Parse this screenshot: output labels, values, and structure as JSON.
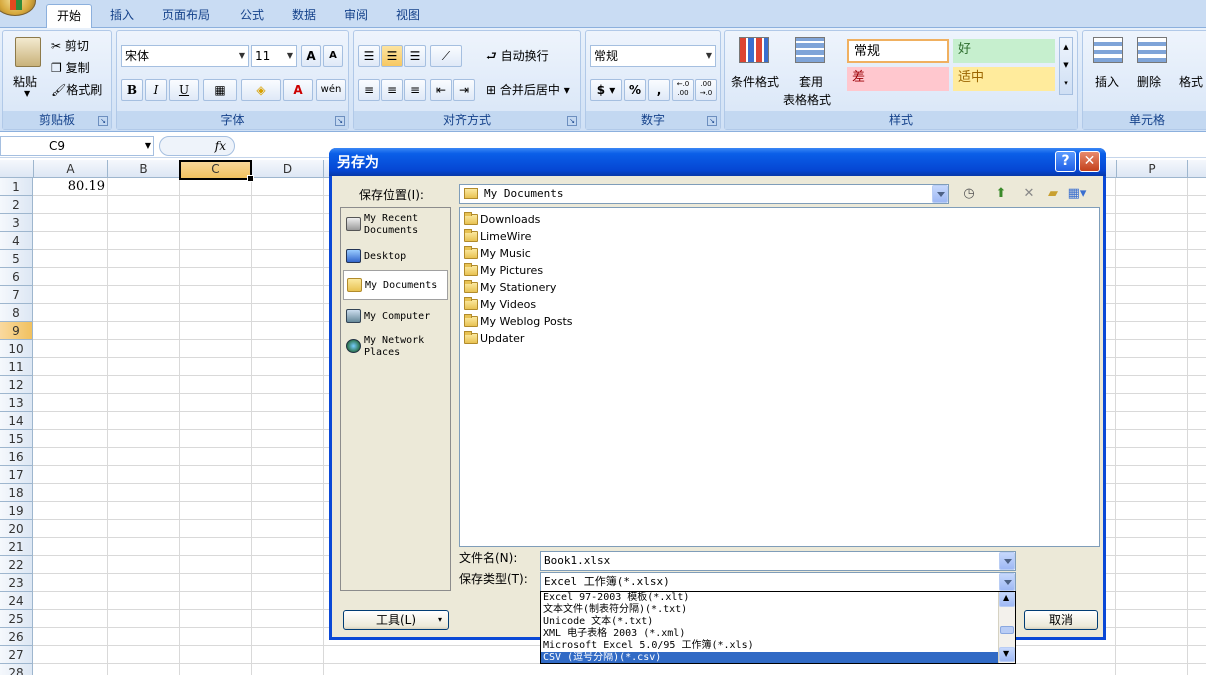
{
  "ribbon": {
    "tabs": [
      "开始",
      "插入",
      "页面布局",
      "公式",
      "数据",
      "审阅",
      "视图"
    ],
    "clipboard": {
      "paste": "粘贴",
      "cut": "剪切",
      "copy": "复制",
      "format_painter": "格式刷",
      "label": "剪贴板"
    },
    "font": {
      "name": "宋体",
      "size": "11",
      "bold": "B",
      "italic": "I",
      "underline": "U",
      "label": "字体",
      "grow": "A",
      "shrink": "A",
      "phonetic": "wén"
    },
    "alignment": {
      "wrap": "自动换行",
      "merge": "合并后居中",
      "label": "对齐方式"
    },
    "number": {
      "format": "常规",
      "currency": "$",
      "percent": "%",
      "comma": ",",
      "inc_decimal": "←.0 .00",
      "dec_decimal": ".00 →.0",
      "label": "数字"
    },
    "styles": {
      "cond_format": "条件格式",
      "table_format_1": "套用",
      "table_format_2": "表格格式",
      "normal": "常规",
      "good": "好",
      "bad": "差",
      "neutral": "适中",
      "label": "样式"
    },
    "cells": {
      "insert": "插入",
      "delete": "删除",
      "format": "格式",
      "label": "单元格"
    }
  },
  "formula_bar": {
    "name_box": "C9",
    "fx": "fx"
  },
  "grid": {
    "columns": [
      "A",
      "B",
      "C",
      "D",
      "P"
    ],
    "rows": [
      "1",
      "2",
      "3",
      "4",
      "5",
      "6",
      "7",
      "8",
      "9",
      "10",
      "11",
      "12",
      "13",
      "14",
      "15",
      "16",
      "17",
      "18",
      "19",
      "20",
      "21",
      "22",
      "23",
      "24",
      "25",
      "26",
      "27",
      "28"
    ],
    "a1_value": "80.19"
  },
  "dialog": {
    "title": "另存为",
    "help": "?",
    "close": "✕",
    "save_in_label": "保存位置(I):",
    "save_in_value": "My Documents",
    "places": [
      {
        "line1": "My Recent",
        "line2": "Documents"
      },
      {
        "line1": "Desktop",
        "line2": ""
      },
      {
        "line1": "My Documents",
        "line2": ""
      },
      {
        "line1": "My Computer",
        "line2": ""
      },
      {
        "line1": "My Network",
        "line2": "Places"
      }
    ],
    "files": [
      "Downloads",
      "LimeWire",
      "My Music",
      "My Pictures",
      "My Stationery",
      "My Videos",
      "My Weblog Posts",
      "Updater"
    ],
    "filename_label": "文件名(N):",
    "filename_value": "Book1.xlsx",
    "filetype_label": "保存类型(T):",
    "filetype_value": "Excel 工作簿(*.xlsx)",
    "filetype_options": [
      "Excel 97-2003 模板(*.xlt)",
      "文本文件(制表符分隔)(*.txt)",
      "Unicode 文本(*.txt)",
      "XML 电子表格 2003 (*.xml)",
      "Microsoft Excel 5.0/95 工作簿(*.xls)",
      "CSV (逗号分隔)(*.csv)"
    ],
    "tools_button": "工具(L)",
    "cancel_button": "取消"
  }
}
